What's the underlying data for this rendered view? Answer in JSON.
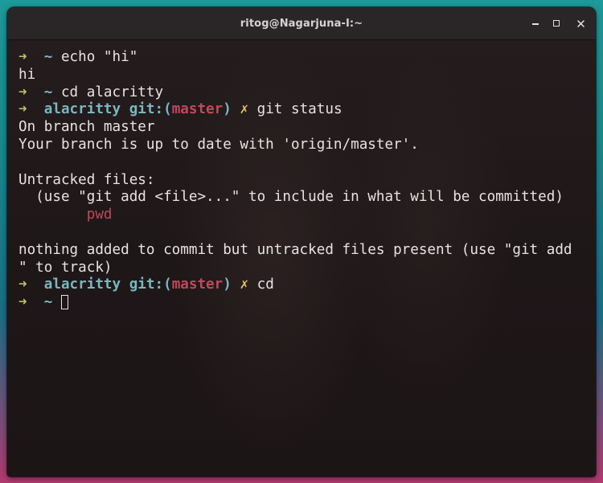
{
  "window": {
    "title": "ritog@Nagarjuna-I:~",
    "controls": {
      "minimize": "minimize-icon",
      "maximize": "maximize-icon",
      "close": "close-icon"
    }
  },
  "prompt": {
    "arrow": "➜",
    "home": "~",
    "dir": "alacritty",
    "git_prefix": "git:(",
    "branch": "master",
    "git_suffix": ")",
    "dirty": "✗"
  },
  "terminal": {
    "cmd1": "echo \"hi\"",
    "out1": "hi",
    "cmd2": "cd alacritty",
    "cmd3": "git status",
    "status_l1": "On branch master",
    "status_l2": "Your branch is up to date with 'origin/master'.",
    "status_l3": "Untracked files:",
    "status_l4": "  (use \"git add <file>...\" to include in what will be committed)",
    "status_file": "pwd",
    "status_l5": "nothing added to commit but untracked files present (use \"git add",
    "status_l6": "\" to track)",
    "cmd4": "cd"
  },
  "colors": {
    "arrow": "#b4c36a",
    "dir": "#79b7bf",
    "branch": "#c0495a",
    "dirty": "#dec46f",
    "text": "#e7e3e3",
    "background": "#1e1718",
    "titlebar": "#2a2627"
  }
}
